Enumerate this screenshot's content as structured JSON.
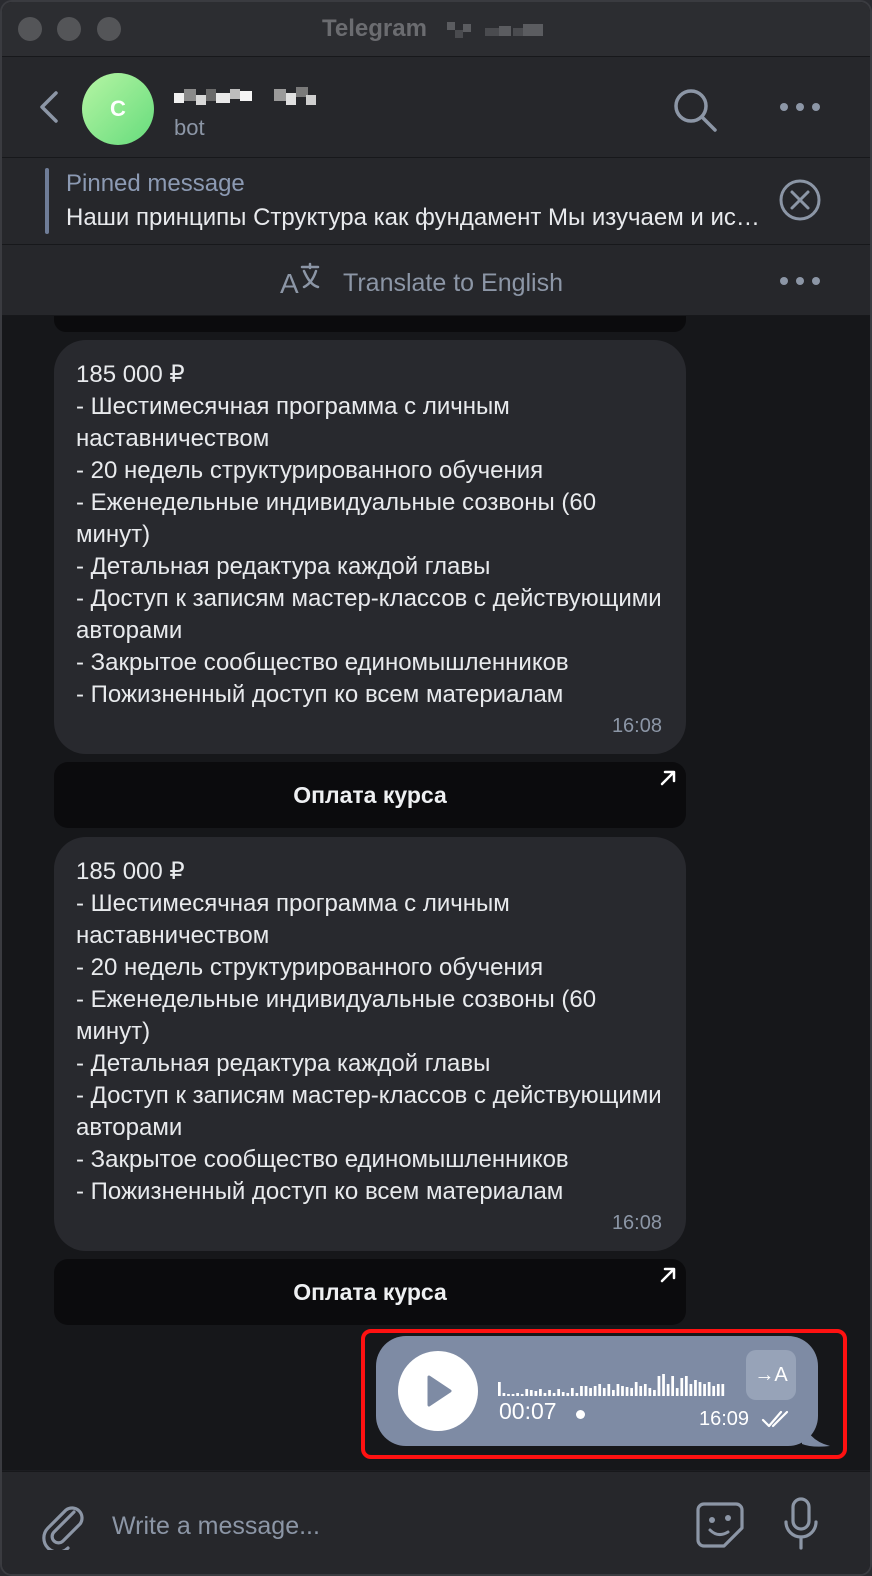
{
  "window": {
    "title": "Telegram",
    "title_suffix_redacted": true
  },
  "header": {
    "avatar_letter": "C",
    "chat_name_redacted": true,
    "chat_subtitle": "bot"
  },
  "pinned": {
    "title": "Pinned message",
    "text": "Наши принципы  Структура как фундамент Мы изучаем и используем проверенные структуры"
  },
  "translate_bar": {
    "label": "Translate to English"
  },
  "messages": [
    {
      "text": "185 000 ₽\n- Шестимесячная программа с личным наставничеством\n- 20 недель структурированного обучения\n- Еженедельные индивидуальные созвоны (60 минут)\n- Детальная редактура каждой главы\n- Доступ к записям мастер-классов с действующими авторами\n- Закрытое сообщество единомышленников\n- Пожизненный доступ ко всем материалам",
      "time": "16:08",
      "button_label": "Оплата курса"
    },
    {
      "text": "185 000 ₽\n- Шестимесячная программа с личным наставничеством\n- 20 недель структурированного обучения\n- Еженедельные индивидуальные созвоны (60 минут)\n- Детальная редактура каждой главы\n- Доступ к записям мастер-классов с действующими авторами\n- Закрытое сообщество единомышленников\n- Пожизненный доступ ко всем материалам",
      "time": "16:08",
      "button_label": "Оплата курса"
    }
  ],
  "voice_message": {
    "duration": "00:07",
    "time": "16:09",
    "transcribe_label": "→A",
    "status": "read",
    "bubble_color": "#7e8ba4"
  },
  "composer": {
    "placeholder": "Write a message..."
  },
  "colors": {
    "accent": "#8c9ab3",
    "highlight_box": "#ff1111",
    "avatar_gradient": [
      "#b6f5a4",
      "#66dc7c"
    ]
  },
  "icons": [
    "back-arrow-icon",
    "search-icon",
    "more-icon",
    "close-icon",
    "translate-icon",
    "link-arrow-icon",
    "play-icon",
    "transcribe-icon",
    "double-check-icon",
    "paperclip-icon",
    "sticker-icon",
    "microphone-icon"
  ]
}
